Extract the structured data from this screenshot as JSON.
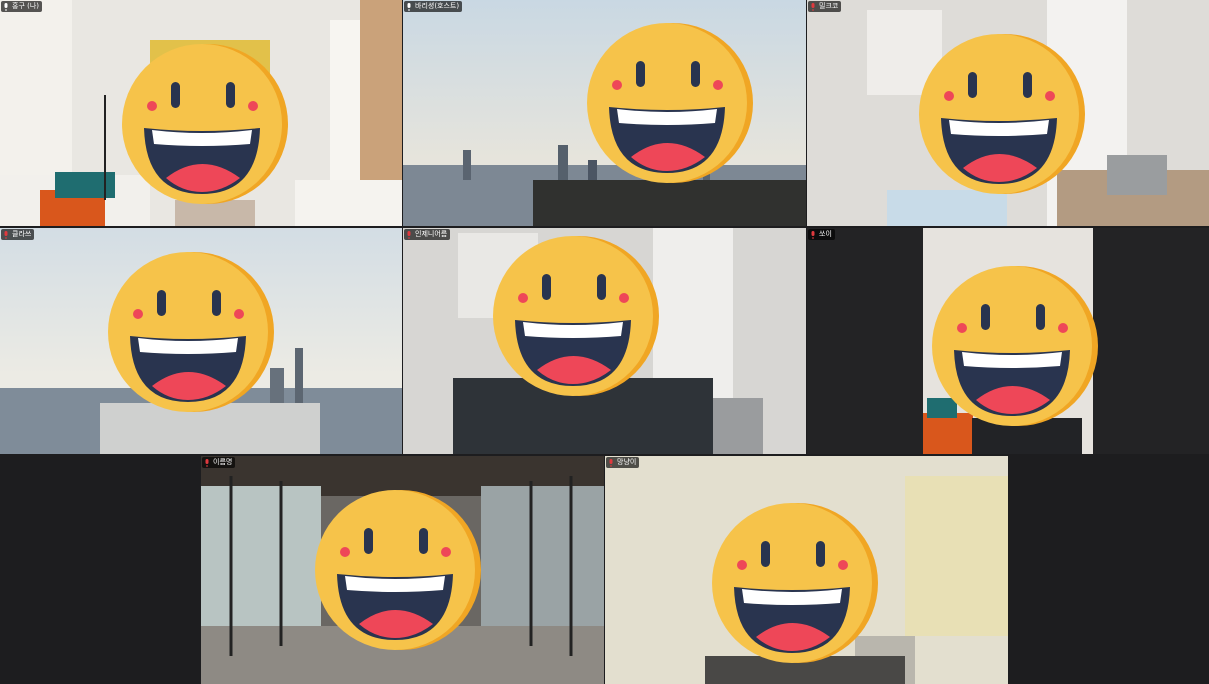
{
  "app": {
    "view": "gallery"
  },
  "participants": [
    {
      "id": "t1",
      "name": "홍구 (나)",
      "mic_muted": false,
      "highlighted": true
    },
    {
      "id": "t2",
      "name": "바리셩(호스트)",
      "mic_muted": false,
      "highlighted": true
    },
    {
      "id": "t3",
      "name": "밀크코",
      "mic_muted": true,
      "highlighted": false
    },
    {
      "id": "t4",
      "name": "클라쓰",
      "mic_muted": true,
      "highlighted": false
    },
    {
      "id": "t5",
      "name": "인제니어름",
      "mic_muted": true,
      "highlighted": false
    },
    {
      "id": "t6",
      "name": "쏘이",
      "mic_muted": true,
      "highlighted": false
    },
    {
      "id": "t7",
      "name": "이름명",
      "mic_muted": true,
      "highlighted": false
    },
    {
      "id": "t8",
      "name": "망냥이",
      "mic_muted": true,
      "highlighted": false
    }
  ],
  "colors": {
    "active_border": "#2fb58a",
    "muted_mic": "#e0393e",
    "face_yellow": "#f6c34a",
    "face_shadow": "#f0a624"
  },
  "icons": [
    "mic-muted-icon",
    "mic-icon",
    "smiley-face-icon"
  ]
}
